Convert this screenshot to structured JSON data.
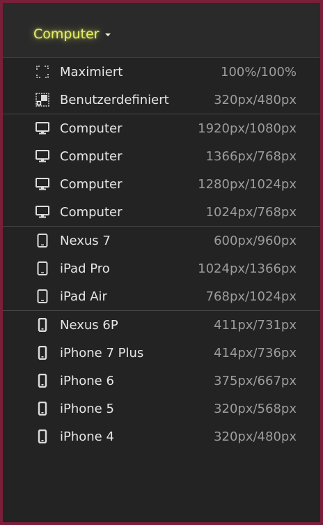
{
  "header": {
    "dropdown_label": "Computer",
    "accent_color": "#e4ef63"
  },
  "sections": [
    {
      "items": [
        {
          "icon": "maximize-icon",
          "label": "Maximiert",
          "size": "100%/100%"
        },
        {
          "icon": "custom-size-icon",
          "label": "Benutzerdefiniert",
          "size": "320px/480px"
        }
      ]
    },
    {
      "items": [
        {
          "icon": "monitor-icon",
          "label": "Computer",
          "size": "1920px/1080px"
        },
        {
          "icon": "monitor-icon",
          "label": "Computer",
          "size": "1366px/768px"
        },
        {
          "icon": "monitor-icon",
          "label": "Computer",
          "size": "1280px/1024px"
        },
        {
          "icon": "monitor-icon",
          "label": "Computer",
          "size": "1024px/768px"
        }
      ]
    },
    {
      "items": [
        {
          "icon": "tablet-icon",
          "label": "Nexus 7",
          "size": "600px/960px"
        },
        {
          "icon": "tablet-icon",
          "label": "iPad Pro",
          "size": "1024px/1366px"
        },
        {
          "icon": "tablet-icon",
          "label": "iPad Air",
          "size": "768px/1024px"
        }
      ]
    },
    {
      "items": [
        {
          "icon": "phone-icon",
          "label": "Nexus 6P",
          "size": "411px/731px"
        },
        {
          "icon": "phone-icon",
          "label": "iPhone 7 Plus",
          "size": "414px/736px"
        },
        {
          "icon": "phone-icon",
          "label": "iPhone 6",
          "size": "375px/667px"
        },
        {
          "icon": "phone-icon",
          "label": "iPhone 5",
          "size": "320px/568px"
        },
        {
          "icon": "phone-icon",
          "label": "iPhone 4",
          "size": "320px/480px"
        }
      ]
    }
  ]
}
